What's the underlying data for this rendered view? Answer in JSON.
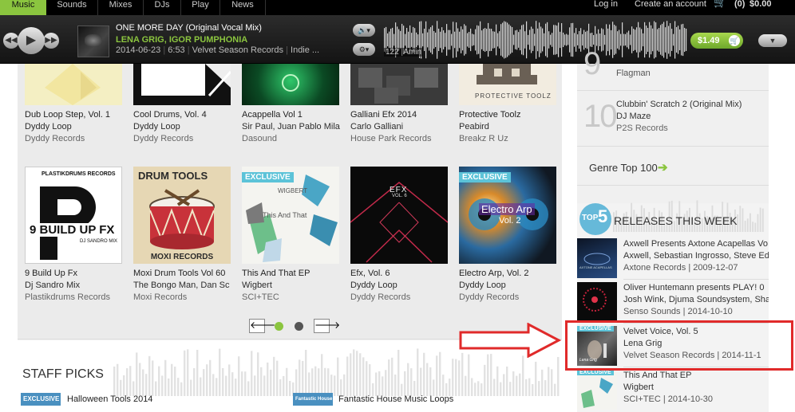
{
  "nav": {
    "items": [
      "Music",
      "Sounds",
      "Mixes",
      "DJs",
      "Play",
      "News"
    ],
    "login": "Log in",
    "create_account": "Create an account",
    "cart_count": "(0)",
    "cart_total": "$0.00"
  },
  "player": {
    "title": "ONE MORE DAY (Original Vocal Mix)",
    "artists": "LENA GRIG, IGOR PUMPHONIA",
    "date": "2014-06-23",
    "duration": "6:53",
    "label": "Velvet Season Records",
    "genre": "Indie ...",
    "bpm": "122",
    "key": "Amin",
    "price": "$1.49",
    "accent": "#8bc53f"
  },
  "releases_top": [
    {
      "title": "Dub Loop Step, Vol. 1",
      "artist": "Dyddy Loop",
      "label": "Dyddy Records"
    },
    {
      "title": "Cool Drums, Vol. 4",
      "artist": "Dyddy Loop",
      "label": "Dyddy Records"
    },
    {
      "title": "Acappella Vol 1",
      "artist": "Sir Paul, Juan Pablo Mila",
      "label": "Dasound"
    },
    {
      "title": "Galliani Efx 2014",
      "artist": "Carlo Galliani",
      "label": "House Park Records"
    },
    {
      "title": "Protective Toolz",
      "artist": "Peabird",
      "label": "Breakz R Uz"
    }
  ],
  "releases_bottom": [
    {
      "title": "9 Build Up Fx",
      "artist": "Dj Sandro Mix",
      "label": "Plastikdrums Records",
      "cover_text": "9 BUILD UP FX",
      "cover_sub": "DJ SANDRO MIX",
      "cover_top": "PLASTIKDRUMS RECORDS"
    },
    {
      "title": "Moxi Drum Tools Vol 60",
      "artist": "The Bongo Man, Dan Sc",
      "label": "Moxi Records",
      "cover_text": "DRUM TOOLS",
      "cover_sub": "MOXI RECORDS"
    },
    {
      "title": "This And That EP",
      "artist": "Wigbert",
      "label": "SCI+TEC",
      "badge": "EXCLUSIVE",
      "cover_text": "This And That",
      "cover_top": "WIGBERT"
    },
    {
      "title": "Efx, Vol. 6",
      "artist": "Dyddy Loop",
      "label": "Dyddy Records",
      "cover_text": "EFX",
      "cover_sub": "VOL. 6"
    },
    {
      "title": "Electro Arp, Vol. 2",
      "artist": "Dyddy Loop",
      "label": "Dyddy Records",
      "badge": "EXCLUSIVE",
      "cover_text": "Electro Arp",
      "cover_sub": "Vol. 2"
    }
  ],
  "cover_marks": {
    "protective": "PROTECTIVE TOOLZ"
  },
  "staff_picks": {
    "title": "STAFF PICKS",
    "items": [
      {
        "title": "Halloween Tools 2014",
        "badge": "EXCLUSIVE"
      },
      {
        "title": "Fantastic House Music Loops",
        "badge": "Fantastic House Music"
      }
    ]
  },
  "chart": {
    "items": [
      {
        "num": "9",
        "title": "",
        "artist": "Flagman",
        "label": ""
      },
      {
        "num": "10",
        "title": "Clubbin' Scratch 2 (Original Mix)",
        "artist": "DJ Maze",
        "label": "P2S Records"
      }
    ],
    "genre_top": "Genre Top 100"
  },
  "releases_week": {
    "badge_small": "TOP",
    "badge_num": "5",
    "title": "RELEASES THIS WEEK",
    "items": [
      {
        "title": "Axwell Presents Axtone Acapellas Vo",
        "artists": "Axwell, Sebastian Ingrosso, Steve Ed",
        "meta": "Axtone Records | 2009-12-07",
        "cover_text": "AXTONE ACAPELLAS"
      },
      {
        "title": "Oliver Huntemann presents PLAY! 0",
        "artists": "Josh Wink, Djuma Soundsystem, Sha",
        "meta": "Senso Sounds | 2014-10-10"
      },
      {
        "title": "Velvet Voice, Vol. 5",
        "artists": "Lena Grig",
        "meta": "Velvet Season Records | 2014-11-1",
        "badge": "EXCLUSIVE",
        "cover_text": "Lena Grig"
      },
      {
        "title": "This And That EP",
        "artists": "Wigbert",
        "meta": "SCI+TEC | 2014-10-30",
        "badge": "EXCLUSIVE"
      }
    ]
  },
  "colors": {
    "annotation_red": "#e02a2a",
    "exclusive_blue": "#5cc3d8"
  }
}
